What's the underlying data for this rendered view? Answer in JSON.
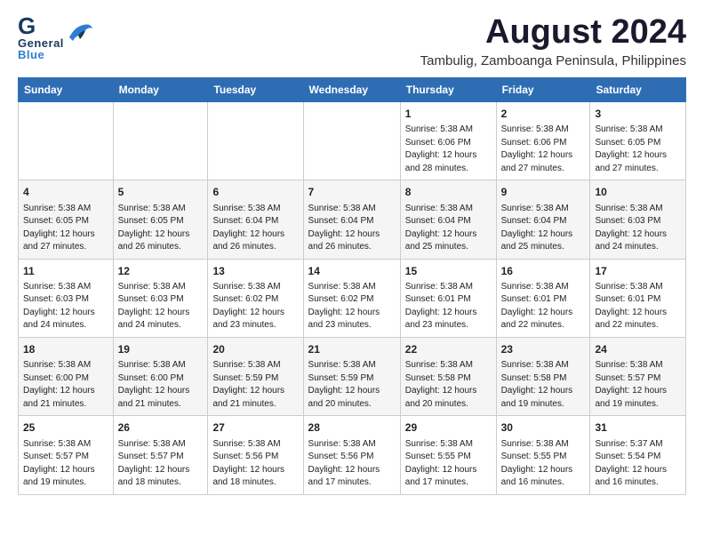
{
  "header": {
    "logo": {
      "general": "General",
      "blue": "Blue"
    },
    "title": "August 2024",
    "location": "Tambulig, Zamboanga Peninsula, Philippines"
  },
  "calendar": {
    "days_of_week": [
      "Sunday",
      "Monday",
      "Tuesday",
      "Wednesday",
      "Thursday",
      "Friday",
      "Saturday"
    ],
    "weeks": [
      [
        {
          "day": "",
          "info": ""
        },
        {
          "day": "",
          "info": ""
        },
        {
          "day": "",
          "info": ""
        },
        {
          "day": "",
          "info": ""
        },
        {
          "day": "1",
          "info": "Sunrise: 5:38 AM\nSunset: 6:06 PM\nDaylight: 12 hours\nand 28 minutes."
        },
        {
          "day": "2",
          "info": "Sunrise: 5:38 AM\nSunset: 6:06 PM\nDaylight: 12 hours\nand 27 minutes."
        },
        {
          "day": "3",
          "info": "Sunrise: 5:38 AM\nSunset: 6:05 PM\nDaylight: 12 hours\nand 27 minutes."
        }
      ],
      [
        {
          "day": "4",
          "info": "Sunrise: 5:38 AM\nSunset: 6:05 PM\nDaylight: 12 hours\nand 27 minutes."
        },
        {
          "day": "5",
          "info": "Sunrise: 5:38 AM\nSunset: 6:05 PM\nDaylight: 12 hours\nand 26 minutes."
        },
        {
          "day": "6",
          "info": "Sunrise: 5:38 AM\nSunset: 6:04 PM\nDaylight: 12 hours\nand 26 minutes."
        },
        {
          "day": "7",
          "info": "Sunrise: 5:38 AM\nSunset: 6:04 PM\nDaylight: 12 hours\nand 26 minutes."
        },
        {
          "day": "8",
          "info": "Sunrise: 5:38 AM\nSunset: 6:04 PM\nDaylight: 12 hours\nand 25 minutes."
        },
        {
          "day": "9",
          "info": "Sunrise: 5:38 AM\nSunset: 6:04 PM\nDaylight: 12 hours\nand 25 minutes."
        },
        {
          "day": "10",
          "info": "Sunrise: 5:38 AM\nSunset: 6:03 PM\nDaylight: 12 hours\nand 24 minutes."
        }
      ],
      [
        {
          "day": "11",
          "info": "Sunrise: 5:38 AM\nSunset: 6:03 PM\nDaylight: 12 hours\nand 24 minutes."
        },
        {
          "day": "12",
          "info": "Sunrise: 5:38 AM\nSunset: 6:03 PM\nDaylight: 12 hours\nand 24 minutes."
        },
        {
          "day": "13",
          "info": "Sunrise: 5:38 AM\nSunset: 6:02 PM\nDaylight: 12 hours\nand 23 minutes."
        },
        {
          "day": "14",
          "info": "Sunrise: 5:38 AM\nSunset: 6:02 PM\nDaylight: 12 hours\nand 23 minutes."
        },
        {
          "day": "15",
          "info": "Sunrise: 5:38 AM\nSunset: 6:01 PM\nDaylight: 12 hours\nand 23 minutes."
        },
        {
          "day": "16",
          "info": "Sunrise: 5:38 AM\nSunset: 6:01 PM\nDaylight: 12 hours\nand 22 minutes."
        },
        {
          "day": "17",
          "info": "Sunrise: 5:38 AM\nSunset: 6:01 PM\nDaylight: 12 hours\nand 22 minutes."
        }
      ],
      [
        {
          "day": "18",
          "info": "Sunrise: 5:38 AM\nSunset: 6:00 PM\nDaylight: 12 hours\nand 21 minutes."
        },
        {
          "day": "19",
          "info": "Sunrise: 5:38 AM\nSunset: 6:00 PM\nDaylight: 12 hours\nand 21 minutes."
        },
        {
          "day": "20",
          "info": "Sunrise: 5:38 AM\nSunset: 5:59 PM\nDaylight: 12 hours\nand 21 minutes."
        },
        {
          "day": "21",
          "info": "Sunrise: 5:38 AM\nSunset: 5:59 PM\nDaylight: 12 hours\nand 20 minutes."
        },
        {
          "day": "22",
          "info": "Sunrise: 5:38 AM\nSunset: 5:58 PM\nDaylight: 12 hours\nand 20 minutes."
        },
        {
          "day": "23",
          "info": "Sunrise: 5:38 AM\nSunset: 5:58 PM\nDaylight: 12 hours\nand 19 minutes."
        },
        {
          "day": "24",
          "info": "Sunrise: 5:38 AM\nSunset: 5:57 PM\nDaylight: 12 hours\nand 19 minutes."
        }
      ],
      [
        {
          "day": "25",
          "info": "Sunrise: 5:38 AM\nSunset: 5:57 PM\nDaylight: 12 hours\nand 19 minutes."
        },
        {
          "day": "26",
          "info": "Sunrise: 5:38 AM\nSunset: 5:57 PM\nDaylight: 12 hours\nand 18 minutes."
        },
        {
          "day": "27",
          "info": "Sunrise: 5:38 AM\nSunset: 5:56 PM\nDaylight: 12 hours\nand 18 minutes."
        },
        {
          "day": "28",
          "info": "Sunrise: 5:38 AM\nSunset: 5:56 PM\nDaylight: 12 hours\nand 17 minutes."
        },
        {
          "day": "29",
          "info": "Sunrise: 5:38 AM\nSunset: 5:55 PM\nDaylight: 12 hours\nand 17 minutes."
        },
        {
          "day": "30",
          "info": "Sunrise: 5:38 AM\nSunset: 5:55 PM\nDaylight: 12 hours\nand 16 minutes."
        },
        {
          "day": "31",
          "info": "Sunrise: 5:37 AM\nSunset: 5:54 PM\nDaylight: 12 hours\nand 16 minutes."
        }
      ]
    ]
  }
}
